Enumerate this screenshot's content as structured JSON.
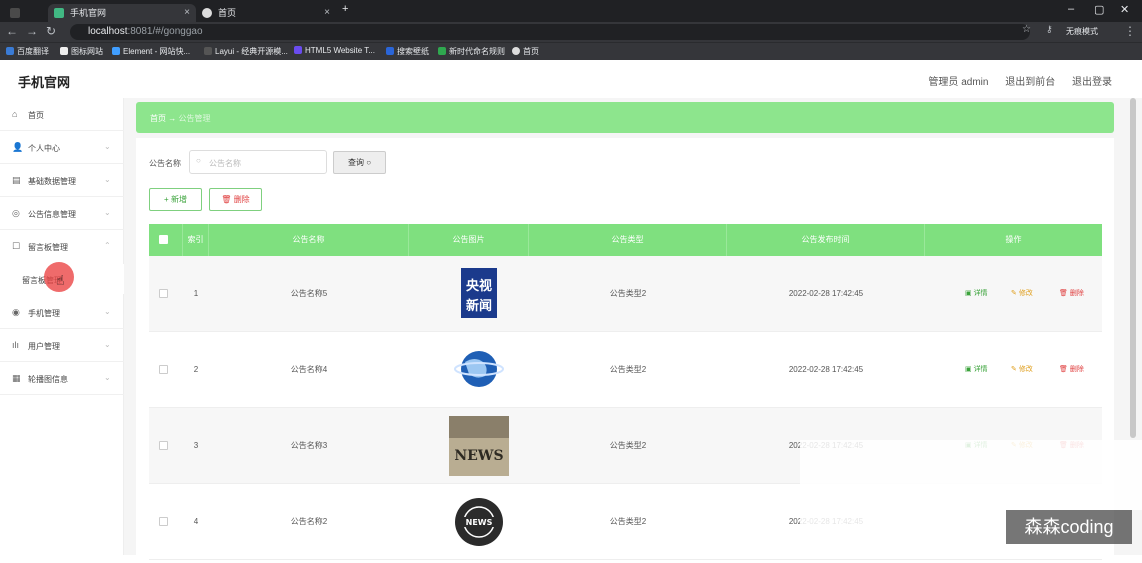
{
  "browser": {
    "tabs": [
      {
        "title": "手机官网"
      },
      {
        "title": "首页"
      }
    ],
    "url_host": "localhost",
    "url_path": ":8081/#/gonggao",
    "profile_label": "无痕模式",
    "bookmarks": [
      "百度翻译",
      "图标网站",
      "Element - 网站快...",
      "Layui - 经典开源模...",
      "HTML5 Website T...",
      "搜索壁纸",
      "新时代命名规则",
      "首页"
    ]
  },
  "header": {
    "brand": "手机官网",
    "admin": "管理员 admin",
    "to_front": "退出到前台",
    "logout": "退出登录"
  },
  "sidebar": {
    "items": [
      {
        "icon": "home-icon",
        "label": "首页"
      },
      {
        "icon": "user-icon",
        "label": "个人中心"
      },
      {
        "icon": "database-icon",
        "label": "基础数据管理"
      },
      {
        "icon": "notice-icon",
        "label": "公告信息管理"
      },
      {
        "icon": "message-icon",
        "label": "留言板管理"
      },
      {
        "icon": "phone-icon",
        "label": "手机管理"
      },
      {
        "icon": "users-icon",
        "label": "用户管理"
      },
      {
        "icon": "carousel-icon",
        "label": "轮播图信息"
      }
    ],
    "sub_item": "留言板管理"
  },
  "breadcrumb": {
    "home": "首页",
    "arrow": "→",
    "current": "公告管理"
  },
  "search": {
    "label": "公告名称",
    "placeholder": "公告名称",
    "button": "查询"
  },
  "actions": {
    "add": "新增",
    "delete": "删除"
  },
  "table": {
    "headers": [
      "索引",
      "公告名称",
      "公告图片",
      "公告类型",
      "公告发布时间",
      "操作"
    ],
    "rows": [
      {
        "index": "1",
        "name": "公告名称5",
        "image": "cctv-news",
        "type": "公告类型2",
        "time": "2022-02-28 17:42:45"
      },
      {
        "index": "2",
        "name": "公告名称4",
        "image": "globe",
        "type": "公告类型2",
        "time": "2022-02-28 17:42:45"
      },
      {
        "index": "3",
        "name": "公告名称3",
        "image": "news-paper",
        "type": "公告类型2",
        "time": "2022-02-28 17:42:45"
      },
      {
        "index": "4",
        "name": "公告名称2",
        "image": "news-badge",
        "type": "公告类型2",
        "time": "2022-02-28 17:42:45"
      }
    ],
    "ops": {
      "detail": "详情",
      "edit": "修改",
      "delete": "删除"
    }
  },
  "watermark": "森森coding",
  "colors": {
    "accent": "#7fe07f",
    "danger": "#e04040",
    "warn": "#e0a020"
  }
}
